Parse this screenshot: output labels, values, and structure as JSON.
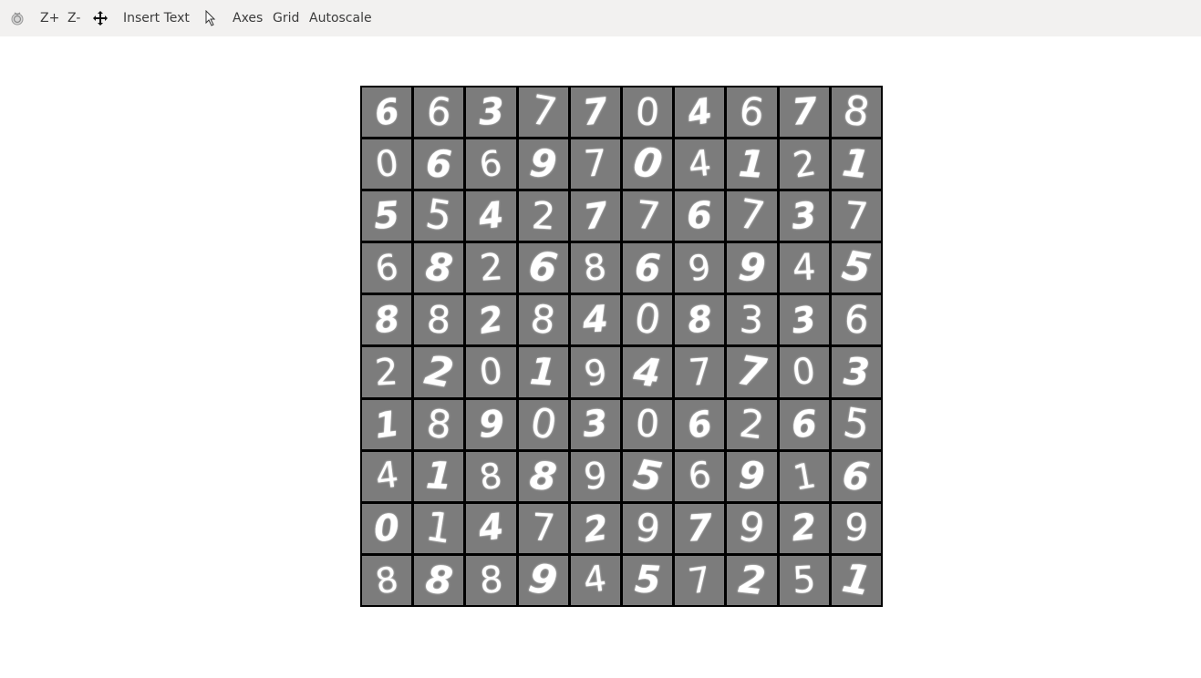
{
  "toolbar": {
    "rotate_icon": "rotate-icon",
    "zoom_in_label": "Z+",
    "zoom_out_label": "Z-",
    "pan_icon": "pan-move-icon",
    "insert_text_label": "Insert Text",
    "select_icon": "mouse-pointer-icon",
    "axes_label": "Axes",
    "grid_label": "Grid",
    "autoscale_label": "Autoscale"
  },
  "figure": {
    "rows": [
      [
        "6",
        "6",
        "3",
        "7",
        "7",
        "0",
        "4",
        "6",
        "7",
        "8"
      ],
      [
        "0",
        "6",
        "6",
        "9",
        "7",
        "0",
        "4",
        "1",
        "2",
        "1"
      ],
      [
        "5",
        "5",
        "4",
        "2",
        "7",
        "7",
        "6",
        "7",
        "3",
        "7"
      ],
      [
        "6",
        "8",
        "2",
        "6",
        "8",
        "6",
        "9",
        "9",
        "4",
        "5"
      ],
      [
        "8",
        "8",
        "2",
        "8",
        "4",
        "0",
        "8",
        "3",
        "3",
        "6"
      ],
      [
        "2",
        "2",
        "0",
        "1",
        "9",
        "4",
        "7",
        "7",
        "0",
        "3"
      ],
      [
        "1",
        "8",
        "9",
        "0",
        "3",
        "0",
        "6",
        "2",
        "6",
        "5"
      ],
      [
        "4",
        "1",
        "8",
        "8",
        "9",
        "5",
        "6",
        "9",
        "1",
        "6"
      ],
      [
        "0",
        "1",
        "4",
        "7",
        "2",
        "9",
        "7",
        "9",
        "2",
        "9"
      ],
      [
        "8",
        "8",
        "8",
        "9",
        "4",
        "5",
        "7",
        "2",
        "5",
        "1"
      ]
    ],
    "colors": {
      "cell_background": "#7c7c7c",
      "grid_lines": "#000000",
      "digit": "#ffffff"
    }
  }
}
